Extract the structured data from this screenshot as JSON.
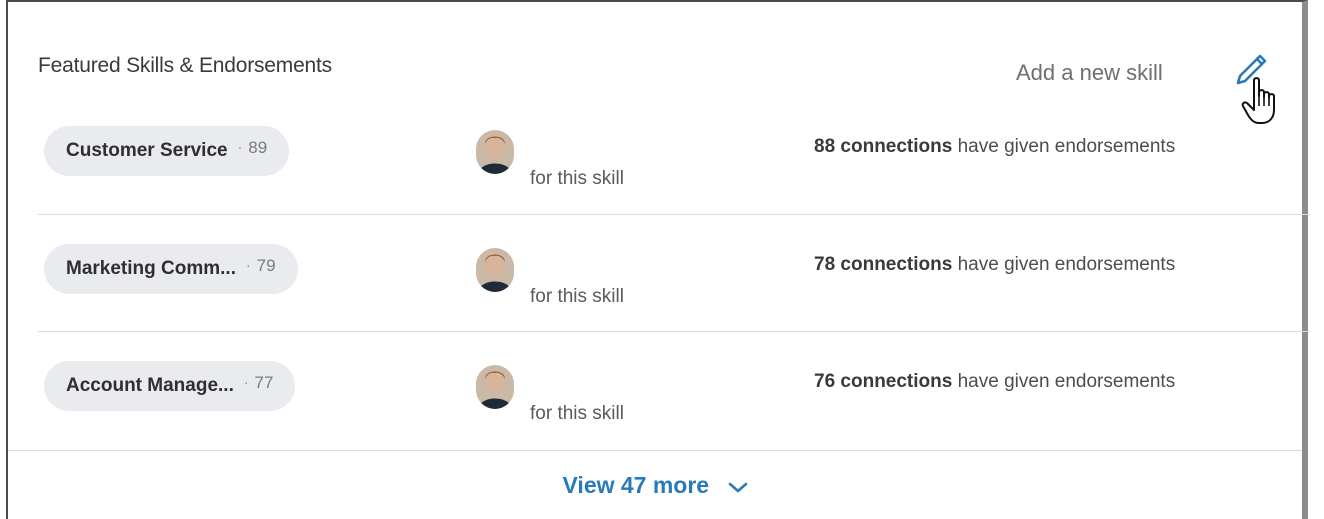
{
  "header": {
    "title": "Featured Skills & Endorsements",
    "add_skill_label": "Add a new skill"
  },
  "icons": {
    "edit": "pencil-icon",
    "cursor": "pointer-hand-cursor"
  },
  "colors": {
    "accent": "#2a7ab8",
    "pill_bg": "#e9ebee",
    "divider": "#dcdcdc"
  },
  "skills": [
    {
      "name": "Customer Service",
      "dot": "·",
      "count": "89",
      "for_skill": "for this skill",
      "endorse_bold": "88 connections",
      "endorse_rest": " have given endorsements"
    },
    {
      "name": "Marketing Comm...",
      "dot": "·",
      "count": "79",
      "for_skill": "for this skill",
      "endorse_bold": "78 connections",
      "endorse_rest": " have given endorsements"
    },
    {
      "name": "Account Manage...",
      "dot": "·",
      "count": "77",
      "for_skill": "for this skill",
      "endorse_bold": "76 connections",
      "endorse_rest": " have given endorsements"
    }
  ],
  "footer": {
    "view_more_label": "View 47 more"
  }
}
